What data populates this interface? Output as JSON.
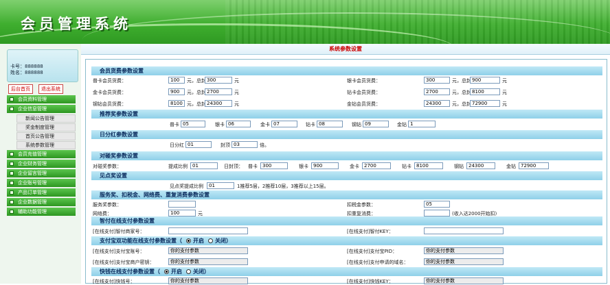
{
  "app_title": "会员管理系统",
  "user": {
    "card_label": "卡号：888888",
    "name_label": "姓名：888888"
  },
  "sidebar": {
    "home_button": "后台首页",
    "logout_button": "退出系统",
    "menu": [
      {
        "label": "会员资料管理"
      },
      {
        "label": "企业信息管理",
        "children": [
          "新闻公告管理",
          "奖金制度管理",
          "首页公告管理",
          "系统参数管理"
        ]
      },
      {
        "label": "会员充值管理"
      },
      {
        "label": "企业财务管理"
      },
      {
        "label": "企业留言管理"
      },
      {
        "label": "企业账号管理"
      },
      {
        "label": "产品订单管理"
      },
      {
        "label": "企业数据管理"
      },
      {
        "label": "辅助功能管理"
      }
    ]
  },
  "main": {
    "title": "系统参数设置",
    "sections": {
      "s1": "会员货费参数设置",
      "s2": "推荐奖参数设置",
      "s3": "日分红参数设置",
      "s4": "对碰奖参数设置",
      "s5": "见点奖设置",
      "s6": "服务奖、扣税金、网络费、重复消费参数设置",
      "s7": "智付在线支付参数设置",
      "s8": "支付宝双功能在线支付参数设置（",
      "s9": "快钱在线支付参数设置（"
    },
    "radio": {
      "on": "开启",
      "off": "关闭",
      "close_paren": "）"
    },
    "fee": {
      "row1": {
        "l1": "普卡会员货费：",
        "v1": "100",
        "cap_unit": "元，总封顶",
        "v2": "300",
        "unit": "元",
        "l2": "银卡会员货费：",
        "v3": "300",
        "v4": "900"
      },
      "row2": {
        "l1": "金卡会员货费：",
        "v1": "900",
        "v2": "2700",
        "l2": "钻卡会员货费：",
        "v3": "2700",
        "v4": "8100"
      },
      "row3": {
        "l1": "钢钻会员货费：",
        "v1": "8100",
        "v2": "24300",
        "l2": "金钻会员货费：",
        "v3": "24300",
        "v4": "72900"
      }
    },
    "recommend": {
      "items": [
        {
          "label": "普卡",
          "value": "05"
        },
        {
          "label": "银卡",
          "value": "06"
        },
        {
          "label": "金卡",
          "value": "07"
        },
        {
          "label": "钻卡",
          "value": "08"
        },
        {
          "label": "钢钻",
          "value": "09"
        },
        {
          "label": "金钻",
          "value": "1"
        }
      ]
    },
    "daily": {
      "l1": "日分红",
      "v1": "01",
      "l2": "封顶",
      "v2": "03",
      "unit": "倍。"
    },
    "pair": {
      "label": "对碰奖参数：",
      "ratio_label": "提成比例",
      "ratio_value": "01",
      "cap_label": "日封顶：",
      "items": [
        {
          "label": "普卡",
          "value": "300"
        },
        {
          "label": "银卡",
          "value": "900"
        },
        {
          "label": "金卡",
          "value": "2700"
        },
        {
          "label": "钻卡",
          "value": "8100"
        },
        {
          "label": "钢钻",
          "value": "24300"
        },
        {
          "label": "金钻",
          "value": "72900"
        }
      ]
    },
    "point": {
      "label": "见点奖提成比例",
      "value": "01",
      "note": "1推荐5层，2推荐10层，3推荐以上15层。"
    },
    "service": {
      "l1": "服务奖参数：",
      "v1": "",
      "l2": "扣税金参数：",
      "v2": "05",
      "l3": "网络费：",
      "v3": "100",
      "unit": "元",
      "l4": "扣重复消费：",
      "v4": "",
      "note4": "(收入达2000开始扣)"
    },
    "zhifu": {
      "l1": "[在线支付]智付商家号：",
      "v1": "",
      "l2": "[在线支付]智付KEY：",
      "v2": ""
    },
    "alipay": {
      "l1": "[在线支付]支付宝账号：",
      "v1": "你的支付参数",
      "l2": "[在线支付]支付宝PID：",
      "v2": "你的支付参数",
      "l3": "[在线支付]支付宝商户密钥：",
      "v3": "你的支付参数",
      "l4": "[在线支付]支付申请的域名：",
      "v4": "你的支付参数"
    },
    "kuaiqian": {
      "l1": "[在线支付]快钱号：",
      "v1": "你的支付参数",
      "l2": "[在线支付]快钱KEY：",
      "v2": "你的支付参数"
    }
  }
}
